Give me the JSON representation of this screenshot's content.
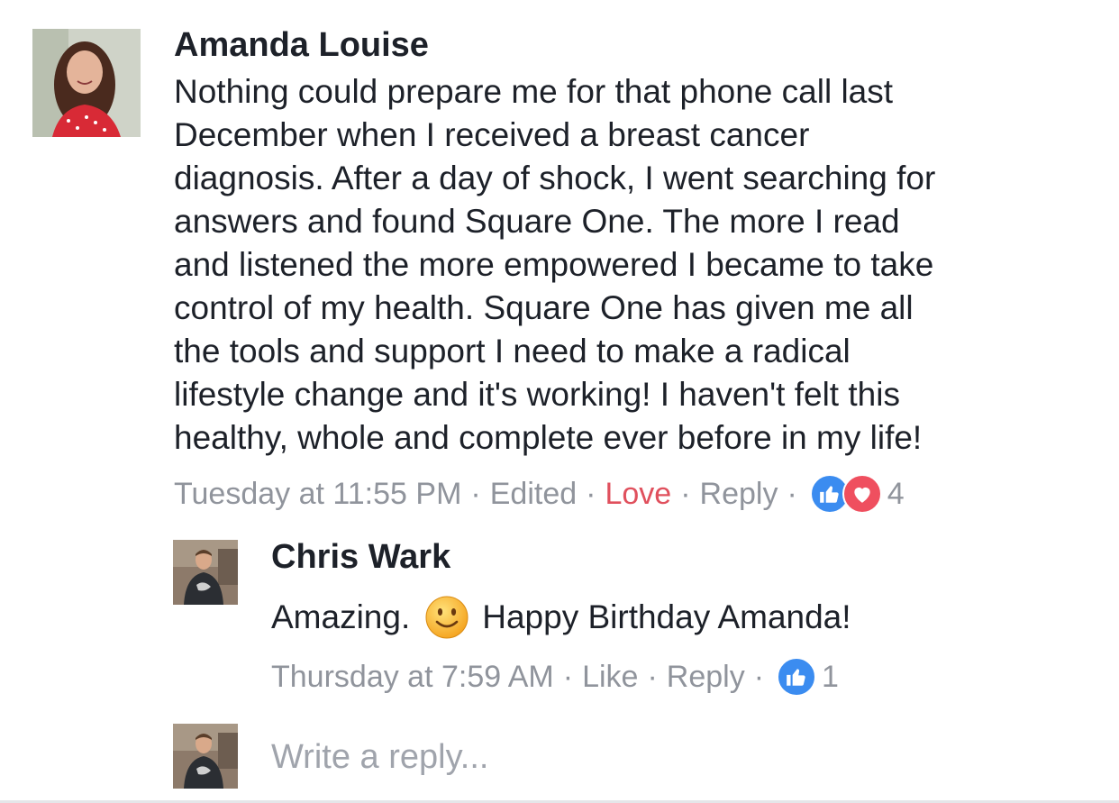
{
  "comment": {
    "author": "Amanda Louise",
    "text_lines": [
      "Nothing could prepare me for that phone call last",
      "December when I received a breast cancer",
      "diagnosis. After a day of shock, I went searching for",
      "answers and found Square One. The more I read",
      "and listened the more empowered I became to take",
      "control of my health. Square One  has given me all",
      "the tools and support I need to make a radical",
      "lifestyle change and it's working! I haven't felt this",
      "healthy, whole and complete ever before in my life!"
    ],
    "timestamp": "Tuesday at 11:55 PM",
    "edited_label": "Edited",
    "love_label": "Love",
    "reply_label": "Reply",
    "reaction_icons": [
      "like-icon",
      "love-icon"
    ],
    "reaction_count": "4",
    "love_color": "#e0505d"
  },
  "reply": {
    "author": "Chris Wark",
    "text_before": "Amazing.",
    "emoji": "slightly-smiling-face-icon",
    "text_after": "Happy Birthday Amanda!",
    "timestamp": "Thursday at 7:59 AM",
    "like_label": "Like",
    "reply_label": "Reply",
    "reaction_icons": [
      "like-icon"
    ],
    "reaction_count": "1"
  },
  "composer": {
    "placeholder": "Write a reply..."
  },
  "separator": "·",
  "colors": {
    "text": "#1d2129",
    "meta": "#90949c",
    "like_blue": "#3b8cf0",
    "love_red": "#ef4f5f"
  }
}
